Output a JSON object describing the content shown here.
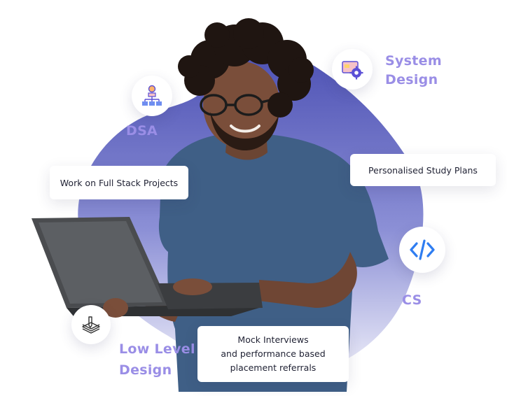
{
  "topics": {
    "system_design": "System\nDesign",
    "dsa": "DSA",
    "cs": "CS",
    "low_level_design": "Low Level\nDesign"
  },
  "cards": {
    "full_stack": "Work on Full Stack Projects",
    "study_plans": "Personalised Study Plans",
    "mock_interviews_line1": "Mock Interviews",
    "mock_interviews_line2": "and performance based",
    "mock_interviews_line3": "placement referrals"
  },
  "icons": {
    "system_design": "system-design-gear-icon",
    "dsa": "flowchart-icon",
    "cs": "code-brackets-icon",
    "low_level_design": "layers-pen-icon"
  },
  "colors": {
    "label": "#9a8ee6",
    "blob_top": "#4f53b5",
    "blob_bottom": "#e8e8f7",
    "code_blue": "#2f7df1",
    "shirt": "#3f5f86"
  }
}
